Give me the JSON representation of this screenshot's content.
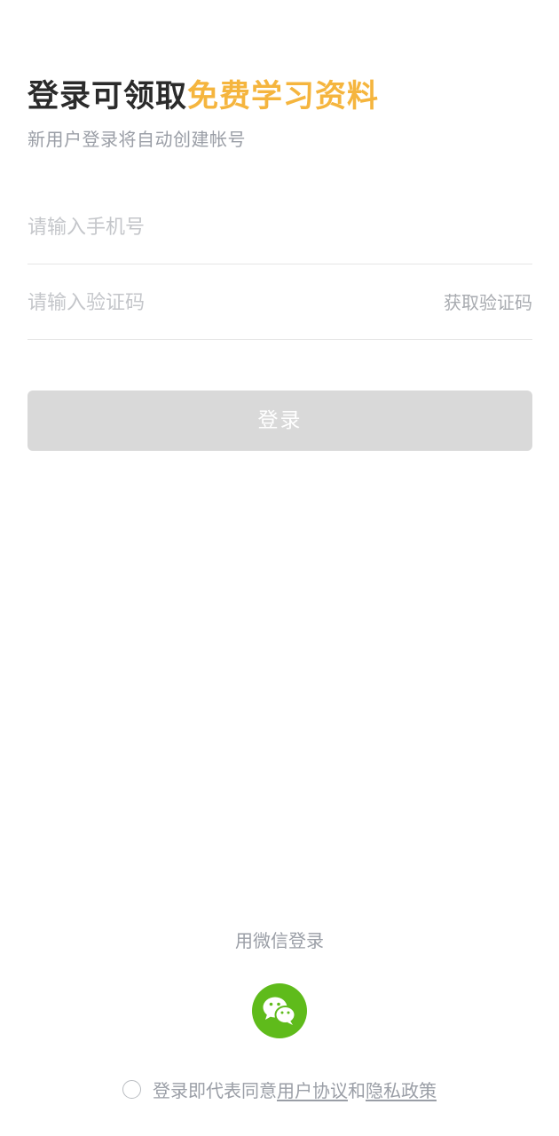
{
  "header": {
    "title_main": "登录可领取",
    "title_accent": "免费学习资料",
    "subtitle": "新用户登录将自动创建帐号"
  },
  "form": {
    "phone_placeholder": "请输入手机号",
    "phone_value": "",
    "code_placeholder": "请输入验证码",
    "code_value": "",
    "get_code_label": "获取验证码",
    "login_label": "登录"
  },
  "wechat": {
    "label": "用微信登录",
    "icon": "wechat-icon"
  },
  "agreement": {
    "checked": false,
    "prefix": "登录即代表同意",
    "user_agreement": "用户协议",
    "conjunction": "和",
    "privacy_policy": "隐私政策"
  },
  "colors": {
    "accent": "#f5b53e",
    "wechat_green": "#5fbb1b",
    "button_disabled": "#d9d9d9"
  }
}
